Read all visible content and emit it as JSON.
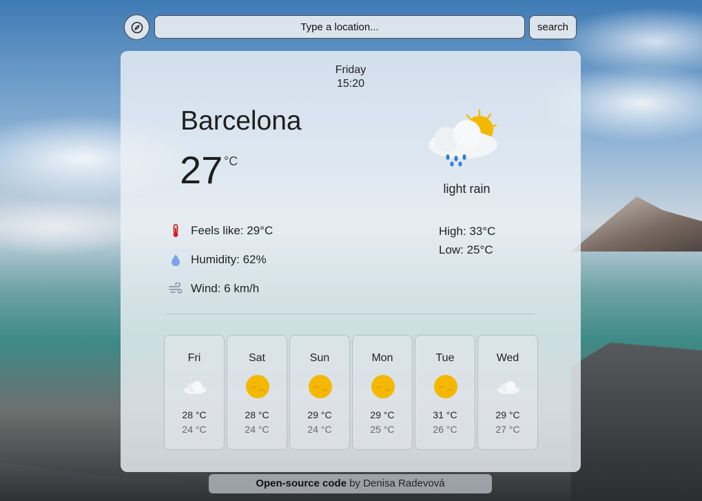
{
  "search": {
    "placeholder": "Type a location...",
    "button_label": "search"
  },
  "current": {
    "day": "Friday",
    "time": "15:20",
    "city": "Barcelona",
    "temperature": "27",
    "unit": "°C",
    "condition": "light rain",
    "feels_like": "Feels like: 29°C",
    "humidity": "Humidity: 62%",
    "wind": "Wind: 6 km/h",
    "high": "High: 33°C",
    "low": "Low: 25°C",
    "icon": "light-rain-sun-icon"
  },
  "forecast": [
    {
      "day": "Fri",
      "high": "28 °C",
      "low": "24 °C",
      "icon": "cloud-icon"
    },
    {
      "day": "Sat",
      "high": "28 °C",
      "low": "24 °C",
      "icon": "sun-icon"
    },
    {
      "day": "Sun",
      "high": "29 °C",
      "low": "24 °C",
      "icon": "sun-icon"
    },
    {
      "day": "Mon",
      "high": "29 °C",
      "low": "25 °C",
      "icon": "sun-icon"
    },
    {
      "day": "Tue",
      "high": "31 °C",
      "low": "26 °C",
      "icon": "sun-icon"
    },
    {
      "day": "Wed",
      "high": "29 °C",
      "low": "27 °C",
      "icon": "cloud-icon"
    }
  ],
  "footer": {
    "link_text": "Open-source code",
    "by_text": " by Denisa Radevová"
  },
  "colors": {
    "sun": "#f5b800",
    "rain": "#2f7fd8",
    "thermometer": "#d42020",
    "humidity": "#7aa6e6"
  }
}
